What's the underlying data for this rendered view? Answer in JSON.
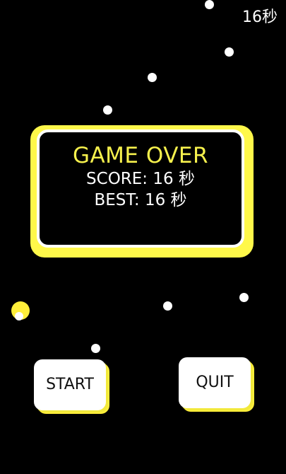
{
  "hud": {
    "time_text": "16秒"
  },
  "game_over_panel": {
    "title": "GAME OVER",
    "score_text": "SCORE: 16 秒",
    "best_text": "BEST: 16 秒"
  },
  "buttons": {
    "start_label": "START",
    "quit_label": "QUIT"
  },
  "colors": {
    "background": "#000000",
    "accent_yellow": "#fff84a",
    "title_yellow": "#f6f14d",
    "dot_white": "#ffffff"
  }
}
